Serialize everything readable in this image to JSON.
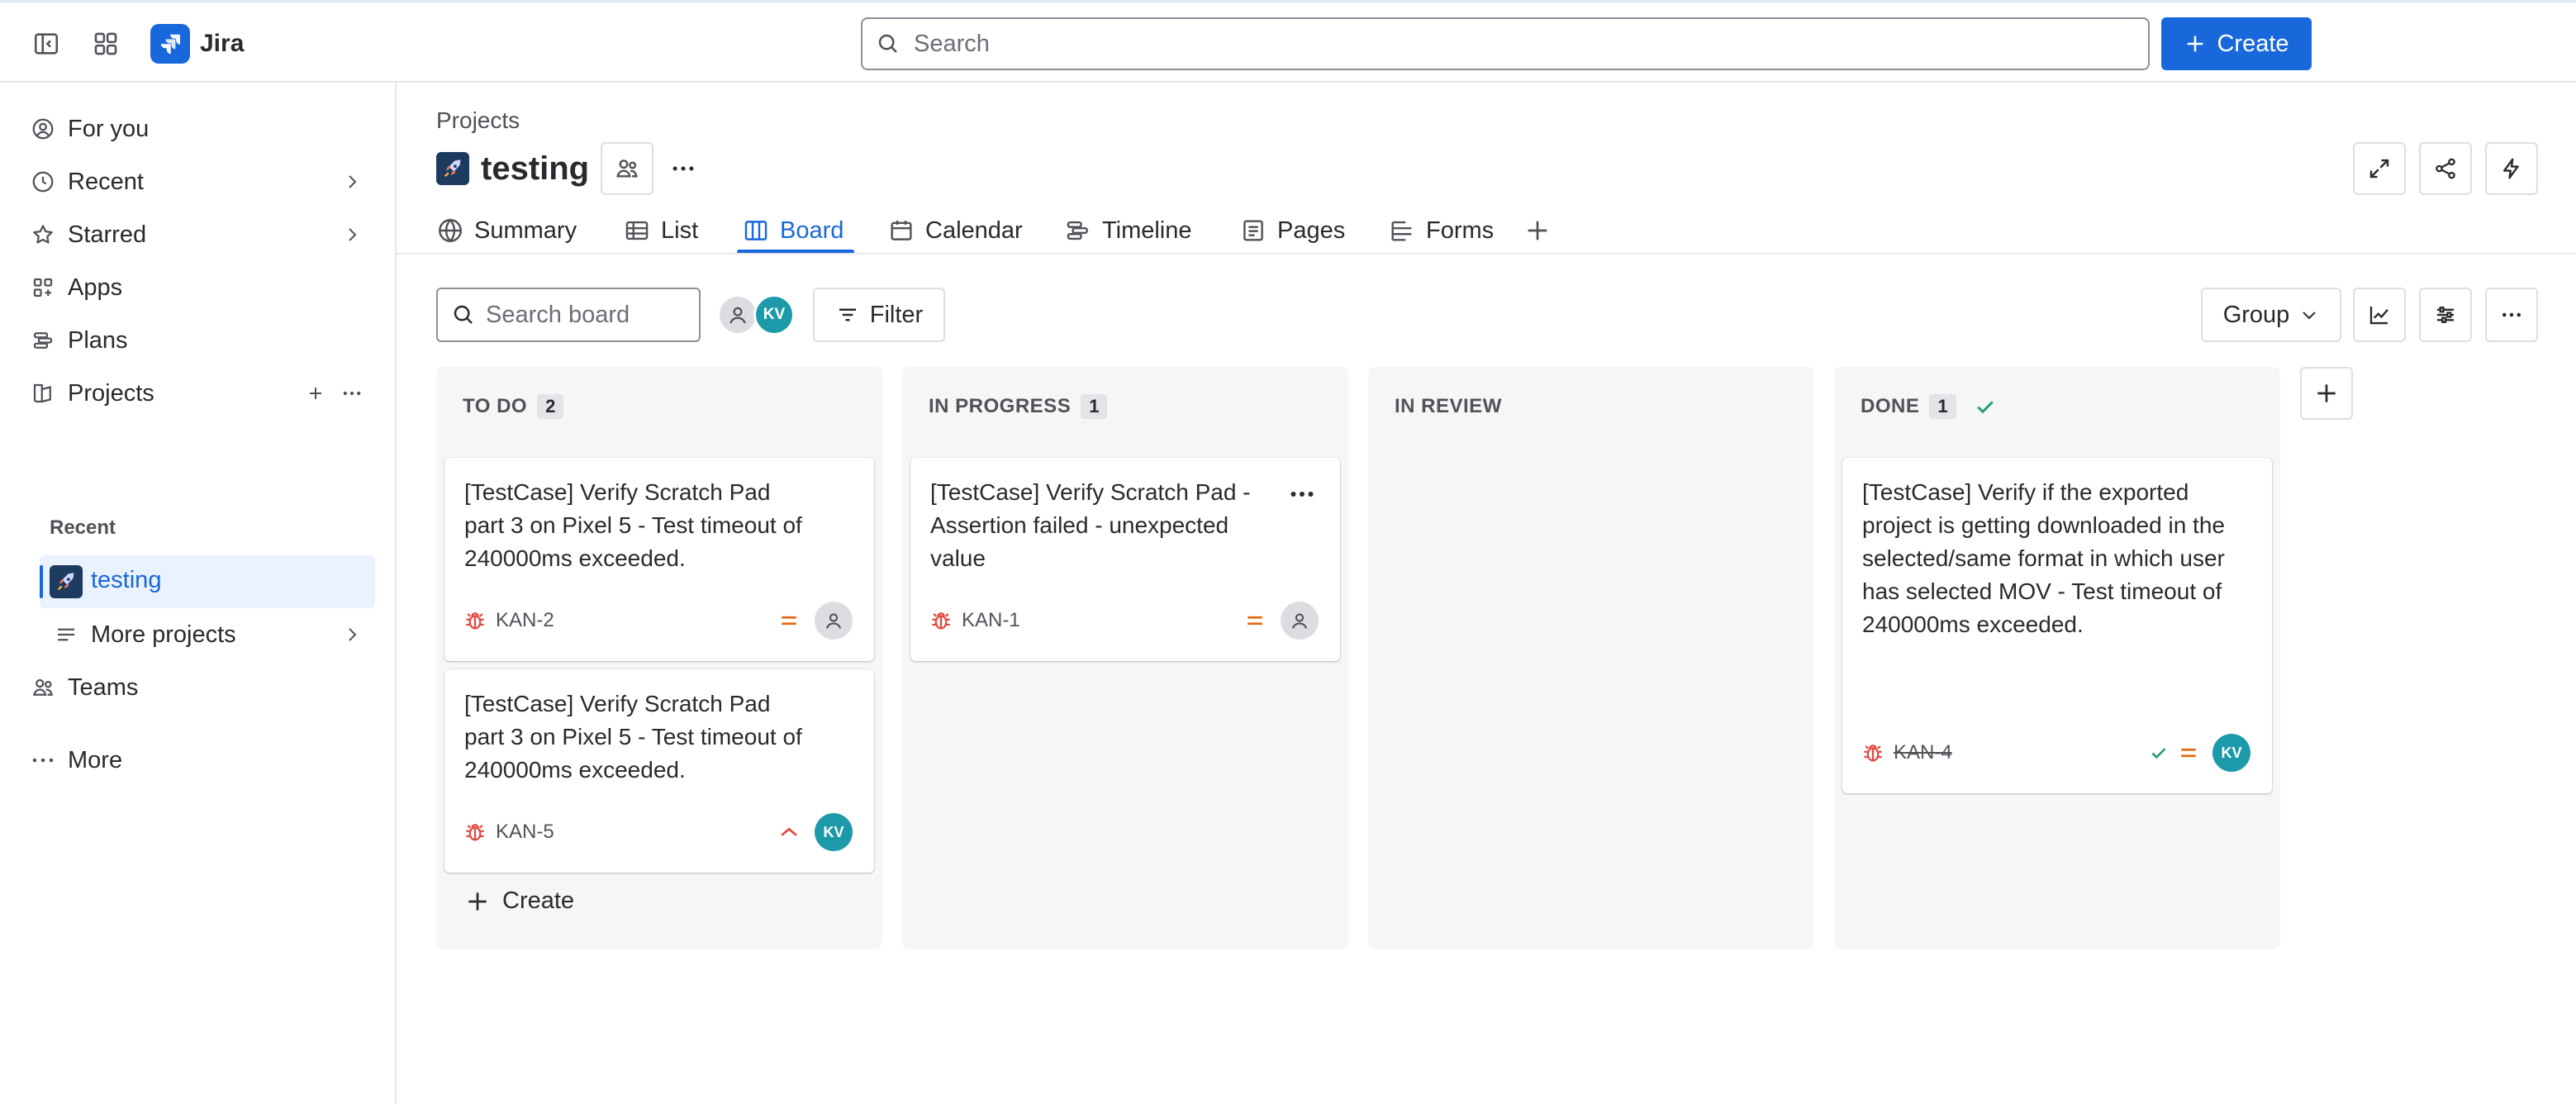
{
  "app": {
    "name": "Jira"
  },
  "search": {
    "placeholder": "Search"
  },
  "header": {
    "create_label": "Create"
  },
  "sidebar": {
    "items": [
      {
        "label": "For you",
        "icon": "user-circle-icon"
      },
      {
        "label": "Recent",
        "icon": "clock-icon"
      },
      {
        "label": "Starred",
        "icon": "star-icon"
      },
      {
        "label": "Apps",
        "icon": "apps-icon"
      },
      {
        "label": "Plans",
        "icon": "plans-icon"
      },
      {
        "label": "Projects",
        "icon": "projects-icon"
      }
    ],
    "recent_section": "Recent",
    "active_project": "testing",
    "more_projects": "More projects",
    "teams": "Teams",
    "more": "More"
  },
  "project": {
    "breadcrumb": "Projects",
    "title": "testing"
  },
  "tabs": [
    {
      "label": "Summary",
      "icon": "globe-icon"
    },
    {
      "label": "List",
      "icon": "list-icon"
    },
    {
      "label": "Board",
      "icon": "board-icon",
      "active": true
    },
    {
      "label": "Calendar",
      "icon": "calendar-icon"
    },
    {
      "label": "Timeline",
      "icon": "timeline-icon"
    },
    {
      "label": "Pages",
      "icon": "pages-icon"
    },
    {
      "label": "Forms",
      "icon": "forms-icon"
    }
  ],
  "toolbar": {
    "search_placeholder": "Search board",
    "avatar_initials": "KV",
    "filter_label": "Filter",
    "group_label": "Group"
  },
  "columns": [
    {
      "title": "TO DO",
      "count": "2",
      "create_label": "Create",
      "cards": [
        {
          "title": "[TestCase] Verify Scratch Pad part 3 on Pixel 5 - Test timeout of 240000ms exceeded.",
          "key": "KAN-2",
          "priority": "medium",
          "assignee": ""
        },
        {
          "title": "[TestCase] Verify Scratch Pad part 3 on Pixel 5 - Test timeout of 240000ms exceeded.",
          "key": "KAN-5",
          "priority": "high",
          "assignee": "KV"
        }
      ]
    },
    {
      "title": "IN PROGRESS",
      "count": "1",
      "cards": [
        {
          "title": "[TestCase] Verify Scratch Pad - Assertion failed - unexpected value",
          "key": "KAN-1",
          "priority": "medium",
          "assignee": ""
        }
      ]
    },
    {
      "title": "IN REVIEW",
      "count": "",
      "cards": []
    },
    {
      "title": "DONE",
      "count": "1",
      "cards": [
        {
          "title": "[TestCase] Verify if the exported project is getting downloaded in the selected/same format in which user has selected MOV - Test timeout of 240000ms exceeded.",
          "key": "KAN-4",
          "priority": "medium",
          "assignee": "KV"
        }
      ]
    }
  ],
  "colors": {
    "brand": "#1868db",
    "bug": "#e2483d",
    "priority_medium": "#e56910",
    "priority_high": "#e2483d",
    "done_check": "#22a06b",
    "avatar_kv": "#1d9aaa"
  }
}
